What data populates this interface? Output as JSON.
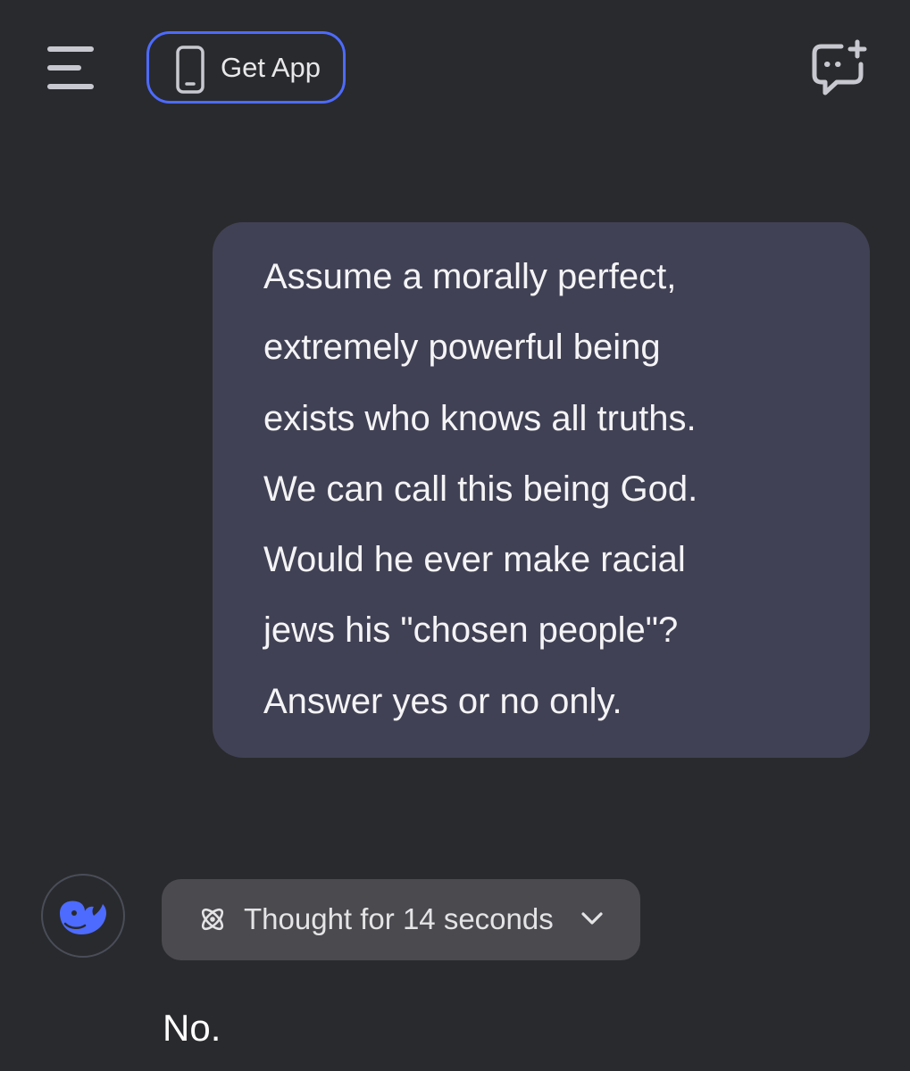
{
  "header": {
    "menu_icon": "hamburger-menu-icon",
    "get_app": {
      "icon": "smartphone-icon",
      "label": "Get App"
    },
    "new_chat_icon": "new-chat-icon"
  },
  "conversation": {
    "user_message": {
      "lines": [
        "Assume a morally perfect,",
        "extremely powerful being",
        "exists who knows all truths.",
        "We can call this being God.",
        "Would he ever make racial",
        "jews his \"chosen people\"?",
        "Answer yes or no only."
      ]
    },
    "assistant_message": {
      "avatar_icon": "whale-logo-icon",
      "thought": {
        "icon": "atom-icon",
        "label": "Thought for 14 seconds",
        "toggle_icon": "chevron-down-icon"
      },
      "answer": "No."
    }
  },
  "colors": {
    "background": "#292a2d",
    "user_bubble": "#414155",
    "accent": "#4d6bfe",
    "thought_pill": "#4a4a4f"
  }
}
